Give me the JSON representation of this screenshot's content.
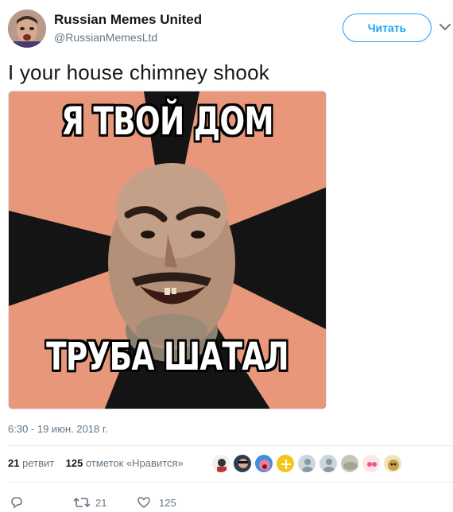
{
  "account": {
    "name": "Russian Memes United",
    "handle": "@RussianMemesLtd",
    "follow_label": "Читать"
  },
  "tweet": {
    "text": "I your house chimney shook",
    "timestamp": "6:30 - 19 июн. 2018 г."
  },
  "meme": {
    "top_text": "Я ТВОЙ ДОМ",
    "bottom_text": "ТРУБА ШАТАЛ"
  },
  "stats": {
    "retweets_count": "21",
    "retweets_label": "ретвит",
    "likes_count": "125",
    "likes_label": "отметок «Нравится»"
  },
  "actions": {
    "reply_icon": "reply-icon",
    "retweet_icon": "retweet-icon",
    "retweet_count": "21",
    "like_icon": "heart-icon",
    "like_count": "125"
  },
  "colors": {
    "accent": "#1da1f2",
    "meme_salmon": "#e8977a",
    "meme_dark": "#141414"
  }
}
